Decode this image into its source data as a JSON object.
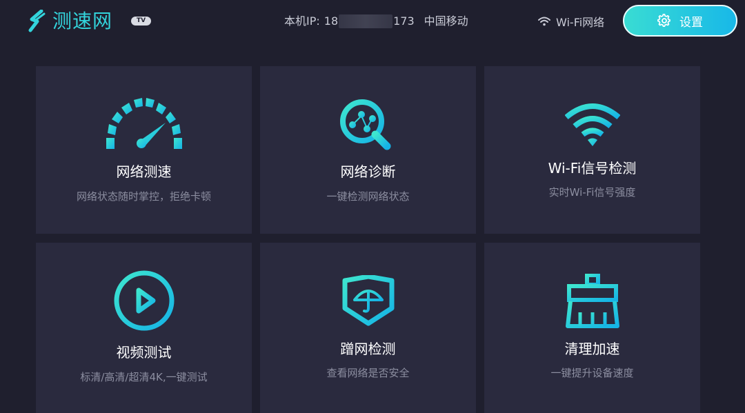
{
  "app": {
    "logo_text": "测速网",
    "badge": "TV",
    "brand_color": "#33d4dc"
  },
  "header": {
    "ip_label": "本机IP:",
    "ip_prefix": "18",
    "ip_suffix": "173",
    "carrier": "中国移动",
    "wifi_label": "Wi-Fi网络",
    "settings_label": "设置"
  },
  "cards": [
    {
      "title": "网络测速",
      "subtitle": "网络状态随时掌控，拒绝卡顿",
      "icon": "speedometer-icon"
    },
    {
      "title": "网络诊断",
      "subtitle": "一键检测网络状态",
      "icon": "network-diagnose-icon"
    },
    {
      "title": "Wi-Fi信号检测",
      "subtitle": "实时Wi-Fi信号强度",
      "icon": "wifi-signal-icon"
    },
    {
      "title": "视频测试",
      "subtitle": "标清/高清/超清4K,一键测试",
      "icon": "play-icon"
    },
    {
      "title": "蹭网检测",
      "subtitle": "查看网络是否安全",
      "icon": "umbrella-shield-icon"
    },
    {
      "title": "清理加速",
      "subtitle": "一键提升设备速度",
      "icon": "broom-icon"
    }
  ],
  "colors": {
    "background": "#1f1f2e",
    "card": "#2a2a3e",
    "accent_start": "#39dcd3",
    "accent_end": "#18b8e8",
    "subtitle": "#8c8ea0"
  }
}
